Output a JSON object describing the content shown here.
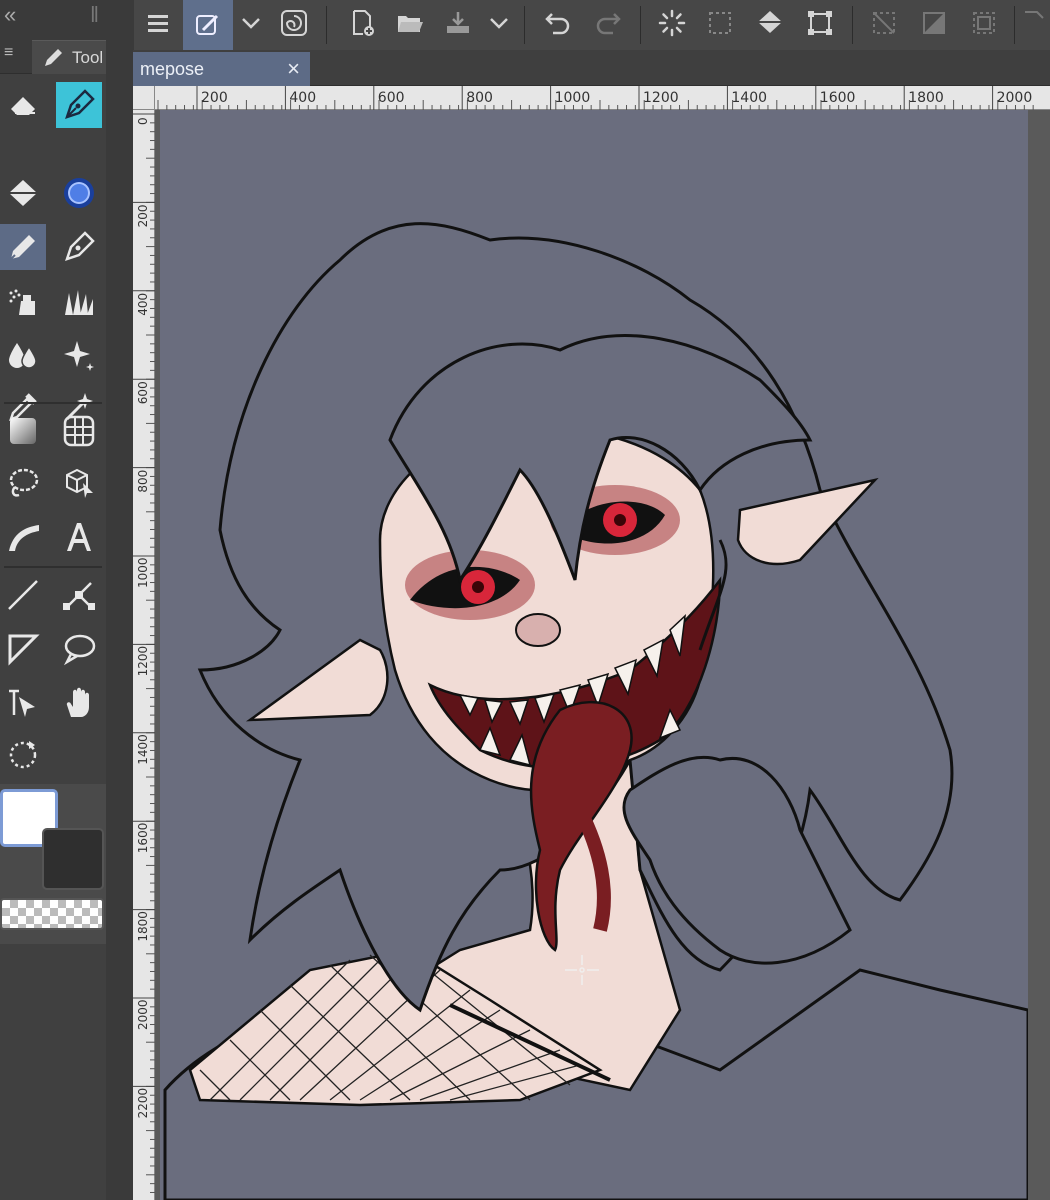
{
  "document": {
    "tab_title": "mepose",
    "close_label": "×"
  },
  "palette": {
    "tab_label": "Tool",
    "menu_icon": "≡"
  },
  "ruler": {
    "horizontal": [
      "200",
      "400",
      "600",
      "800",
      "1000",
      "1200",
      "1400",
      "1600",
      "1800",
      "2000"
    ],
    "vertical": [
      "0",
      "200",
      "400",
      "600",
      "800",
      "1000",
      "1200",
      "1400",
      "1600",
      "1800",
      "2000",
      "2200"
    ]
  },
  "colors": {
    "accent": "#5d6b86",
    "canvas_bg": "#6a6d7e",
    "skin": "#f1dcd6",
    "mouth": "#5e1318"
  },
  "icons": {
    "toolbar": [
      "menu-icon",
      "layer-property-icon",
      "chevron-down-icon",
      "swirl-icon",
      "new-file-icon",
      "open-folder-icon",
      "save-icon",
      "chevron-down-icon",
      "undo-icon",
      "redo-icon",
      "loading-icon",
      "selection-dashed-icon",
      "fill-bucket-icon",
      "transform-icon",
      "clear-icon",
      "fill-gradient-icon",
      "select-all-icon"
    ],
    "tools": [
      "eraser-icon",
      "pen-nib-icon",
      "fill-icon",
      "brush-dot-icon",
      "marker-icon",
      "pen-icon",
      "airbrush-icon",
      "grass-brush-icon",
      "blend-icon",
      "sparkle-icon",
      "eyedropper-icon",
      "magic-wand-icon",
      "gradient-icon",
      "grid-icon",
      "lasso-icon",
      "3d-object-icon",
      "frame-border-icon",
      "text-icon",
      "line-icon",
      "vector-icon",
      "figure-icon",
      "balloon-icon",
      "object-select-icon",
      "hand-icon",
      "rotate-icon"
    ]
  }
}
